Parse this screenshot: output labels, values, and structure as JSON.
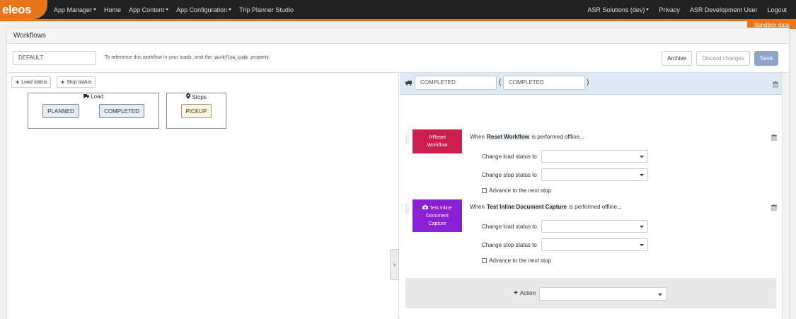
{
  "colors": {
    "brand": "#e8751a",
    "nav_bg": "#222222",
    "reset_tile": "#cc1f50",
    "capture_tile": "#8b1fd6",
    "save_btn": "#8fa4c9",
    "right_header": "#dde9f5"
  },
  "nav": {
    "brand": "eleos",
    "left_items": [
      {
        "label": "App Manager",
        "dropdown": true
      },
      {
        "label": "Home",
        "dropdown": false
      },
      {
        "label": "App Content",
        "dropdown": true
      },
      {
        "label": "App Configuration",
        "dropdown": true
      },
      {
        "label": "Trip Planner Studio",
        "dropdown": false
      }
    ],
    "right_items": [
      {
        "label": "ASR Solutions (dev)",
        "dropdown": true
      },
      {
        "label": "Privacy",
        "dropdown": false
      },
      {
        "label": "ASR Development User",
        "dropdown": false
      },
      {
        "label": "Logout",
        "dropdown": false
      }
    ],
    "sandbox_label": "Sandbox data"
  },
  "panel": {
    "title": "Workflows",
    "workflow_code": "DEFAULT",
    "hint_before": "To reference this workflow in your loads, omit the",
    "hint_code": "workflow_code",
    "hint_after": "property.",
    "archive_label": "Archive",
    "discard_label": "Discard changes",
    "save_label": "Save"
  },
  "left": {
    "load_status_btn": "Load status",
    "stop_status_btn": "Stop status",
    "load_group": {
      "title": "Load",
      "statuses": [
        "PLANNED",
        "COMPLETED"
      ]
    },
    "stops_group": {
      "title": "Stops",
      "statuses": [
        "PICKUP"
      ]
    }
  },
  "right": {
    "status_code": "COMPLETED",
    "status_label": "COMPLETED",
    "open_paren": "(",
    "close_paren": ")",
    "actions": [
      {
        "tile_line1": "Reset",
        "tile_line2": "Workflow",
        "tile_icon": "refresh-icon",
        "when_prefix": "When",
        "action_name": "Reset Workflow",
        "when_suffix": "is performed offline...",
        "load_status_label": "Change load status to",
        "stop_status_label": "Change stop status to",
        "advance_label": "Advance to the next stop"
      },
      {
        "tile_line1": "Test Inline",
        "tile_line2": "Document",
        "tile_line3": "Capture",
        "tile_icon": "camera-icon",
        "when_prefix": "When",
        "action_name": "Test Inline Document Capture",
        "when_suffix": "is performed offline...",
        "load_status_label": "Change load status to",
        "stop_status_label": "Change stop status to",
        "advance_label": "Advance to the next stop"
      }
    ],
    "add_action_label": "Action"
  }
}
